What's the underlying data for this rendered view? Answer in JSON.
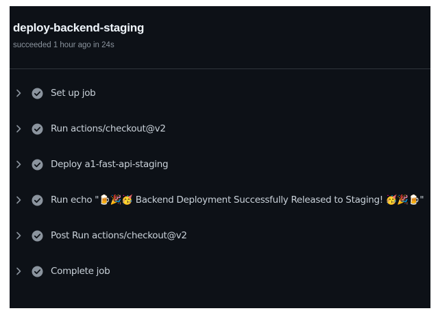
{
  "job": {
    "title": "deploy-backend-staging",
    "status": "succeeded 1 hour ago in 24s"
  },
  "steps": [
    {
      "label": "Set up job"
    },
    {
      "label": "Run actions/checkout@v2"
    },
    {
      "label": "Deploy a1-fast-api-staging"
    },
    {
      "label": "Run echo \"🍺🎉🥳 Backend Deployment Successfully Released to Staging! 🥳🎉🍺\""
    },
    {
      "label": "Post Run actions/checkout@v2"
    },
    {
      "label": "Complete job"
    }
  ],
  "icons": {
    "expand": "chevron-right-icon",
    "status": "check-circle-icon"
  },
  "colors": {
    "background": "#0d1117",
    "text": "#c9d1d9",
    "muted": "#8b949e",
    "check": "#8b949e"
  }
}
